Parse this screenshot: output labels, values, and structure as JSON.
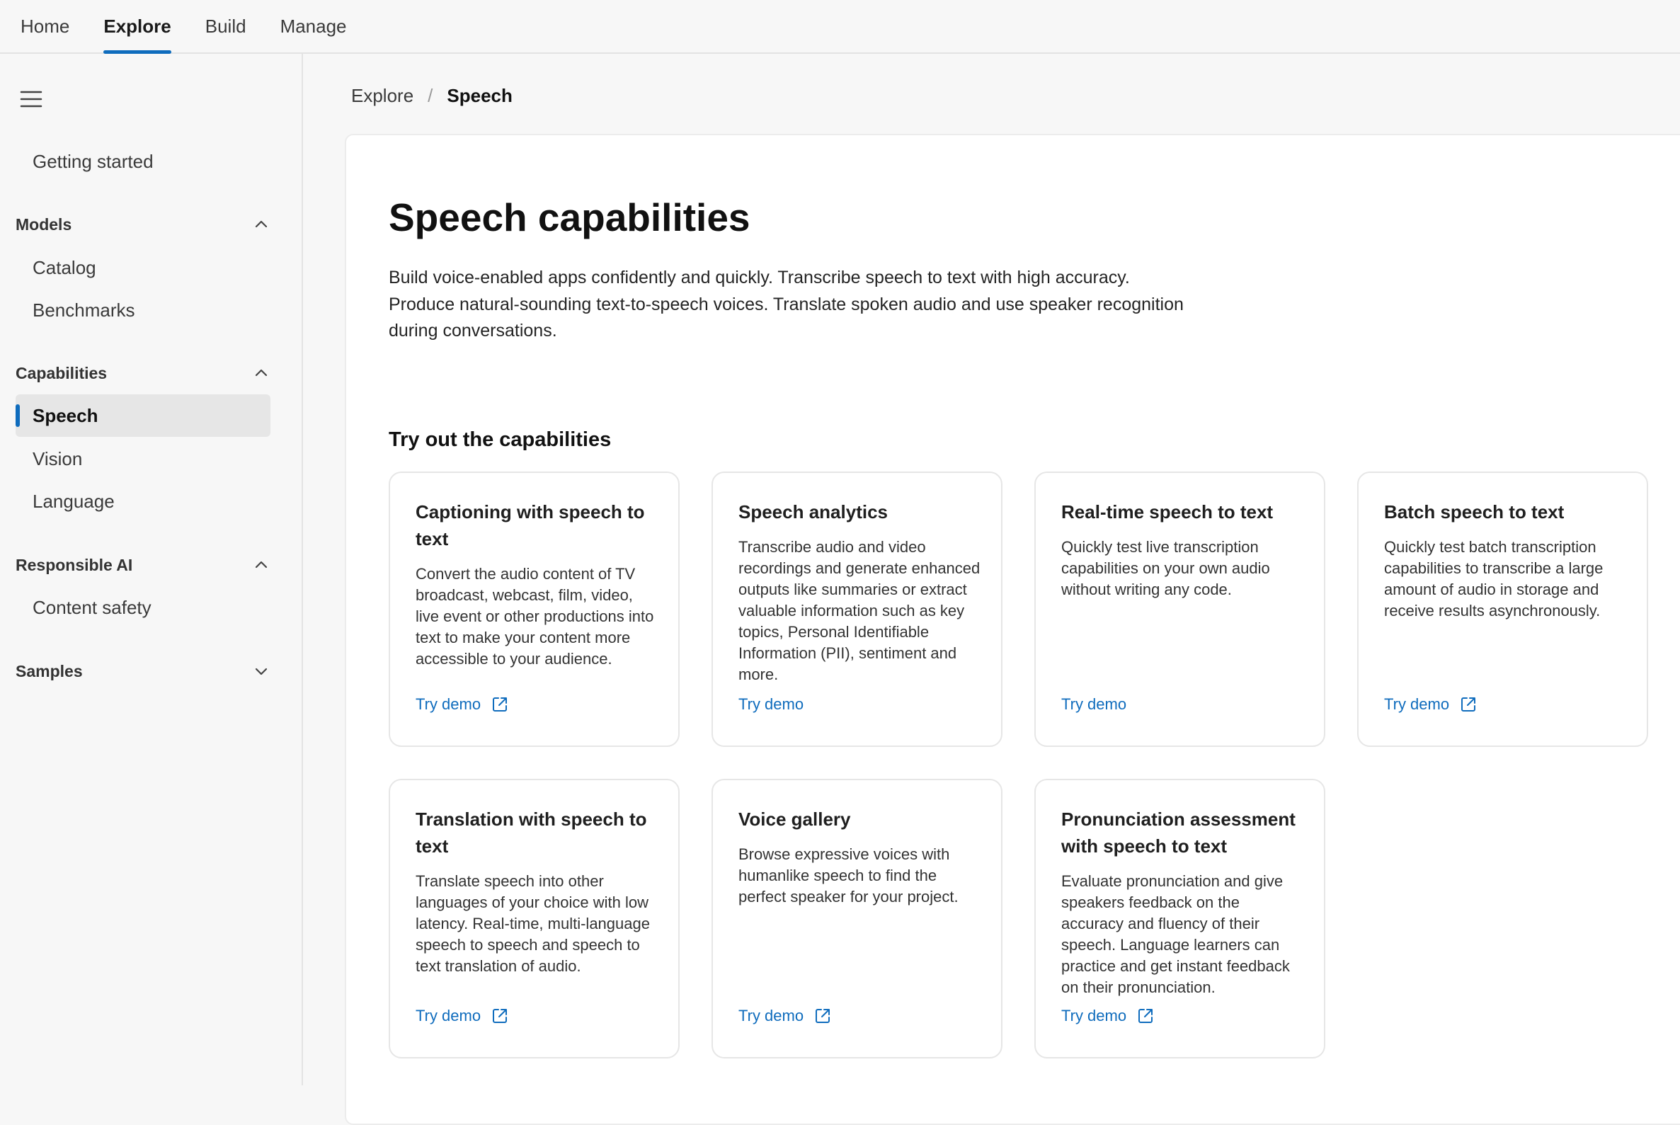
{
  "topnav": {
    "items": [
      {
        "label": "Home"
      },
      {
        "label": "Explore",
        "active": true
      },
      {
        "label": "Build"
      },
      {
        "label": "Manage"
      }
    ]
  },
  "sidebar": {
    "getting_started": "Getting started",
    "sections": [
      {
        "title": "Models",
        "expanded": true,
        "items": [
          "Catalog",
          "Benchmarks"
        ]
      },
      {
        "title": "Capabilities",
        "expanded": true,
        "items": [
          "Speech",
          "Vision",
          "Language"
        ],
        "selected": "Speech"
      },
      {
        "title": "Responsible AI",
        "expanded": true,
        "items": [
          "Content safety"
        ]
      },
      {
        "title": "Samples",
        "expanded": false,
        "items": []
      }
    ]
  },
  "breadcrumb": {
    "parent": "Explore",
    "separator": "/",
    "current": "Speech"
  },
  "page": {
    "title": "Speech capabilities",
    "description": "Build voice-enabled apps confidently and quickly. Transcribe speech to text with high accuracy. Produce natural-sounding text-to-speech voices. Translate spoken audio and use speaker recognition during conversations.",
    "section_title": "Try out the capabilities"
  },
  "cards": [
    {
      "title": "Captioning with speech to text",
      "description": "Convert the audio content of TV broadcast, webcast, film, video, live event or other productions into text to make your content more accessible to your audience.",
      "link": "Try demo",
      "external": true
    },
    {
      "title": "Speech analytics",
      "description": "Transcribe audio and video recordings and generate enhanced outputs like summaries or extract valuable information such as key topics, Personal Identifiable Information (PII), sentiment and more.",
      "link": "Try demo",
      "external": false
    },
    {
      "title": "Real-time speech to text",
      "description": "Quickly test live transcription capabilities on your own audio without writing any code.",
      "link": "Try demo",
      "external": false
    },
    {
      "title": "Batch speech to text",
      "description": "Quickly test batch transcription capabilities to transcribe a large amount of audio in storage and receive results asynchronously.",
      "link": "Try demo",
      "external": true
    },
    {
      "title": "Translation with speech to text",
      "description": "Translate speech into other languages of your choice with low latency. Real-time, multi-language speech to speech and speech to text translation of audio.",
      "link": "Try demo",
      "external": true
    },
    {
      "title": "Voice gallery",
      "description": "Browse expressive voices with humanlike speech to find the perfect speaker for your project.",
      "link": "Try demo",
      "external": true
    },
    {
      "title": "Pronunciation assessment with speech to text",
      "description": "Evaluate pronunciation and give speakers feedback on the accuracy and fluency of their speech. Language learners can practice and get instant feedback on their pronunciation.",
      "link": "Try demo",
      "external": true
    }
  ],
  "icons": {
    "menu": "hamburger-icon",
    "expand": "chevron-up-icon",
    "collapse": "chevron-down-icon",
    "external": "external-link-icon"
  },
  "colors": {
    "accent": "#0f6cbd",
    "background": "#f7f7f7",
    "panel": "#ffffff"
  }
}
